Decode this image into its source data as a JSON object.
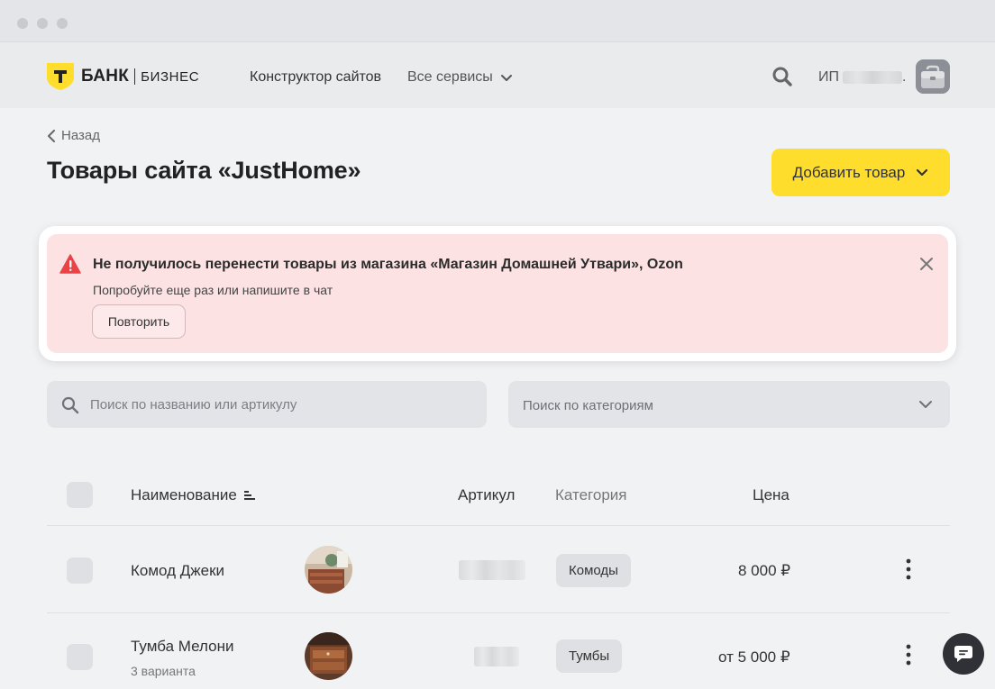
{
  "header": {
    "logo_bank": "БАНК",
    "logo_business": "БИЗНЕС",
    "nav_site_builder": "Конструктор сайтов",
    "nav_all_services": "Все сервисы",
    "user_prefix": "ИП",
    "user_suffix": ".",
    "icons": [
      "shield-logo-icon",
      "chevron-down-icon",
      "search-icon",
      "briefcase-avatar"
    ]
  },
  "page": {
    "back_label": "Назад",
    "title": "Товары сайта «JustHome»",
    "add_button": "Добавить товар"
  },
  "alert": {
    "title": "Не получилось перенести товары из магазина «Магазин Домашней Утвари», Ozon",
    "subtitle": "Попробуйте еще раз или напишите в чат",
    "retry_label": "Повторить",
    "color_bg": "#fce2e3",
    "color_icon": "#e84447"
  },
  "filters": {
    "search_placeholder": "Поиск по названию или артикулу",
    "category_placeholder": "Поиск по категориям"
  },
  "table": {
    "columns": {
      "name": "Наименование",
      "article": "Артикул",
      "category": "Категория",
      "price": "Цена"
    },
    "rows": [
      {
        "name": "Комод Джеки",
        "variants": "",
        "category": "Комоды",
        "price": "8 000 ₽"
      },
      {
        "name": "Тумба Мелони",
        "variants": "3 варианта",
        "category": "Тумбы",
        "price": "от 5 000 ₽"
      }
    ]
  },
  "colors": {
    "accent": "#ffdd2d",
    "background": "#f1f2f4"
  }
}
